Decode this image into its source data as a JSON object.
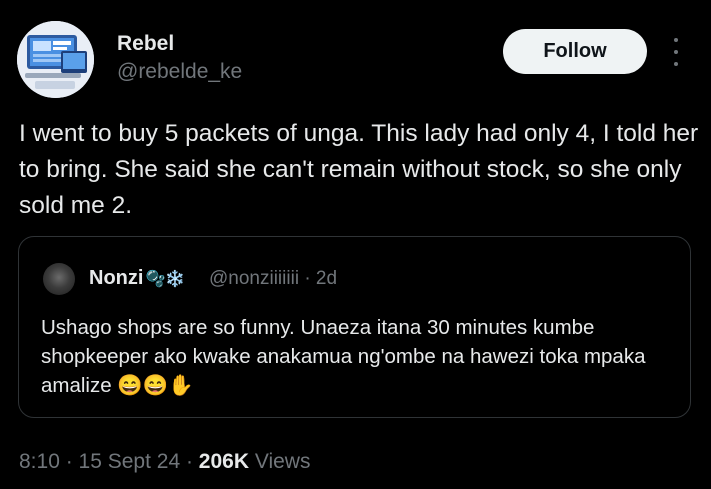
{
  "author": {
    "name": "Rebel",
    "handle": "@rebelde_ke"
  },
  "follow_label": "Follow",
  "more_icon": "more-vertical-icon",
  "tweet_text": "I went to buy 5 packets of unga. This lady had only 4, I told her to bring. She said she can't remain without stock, so she only sold me 2.",
  "quote": {
    "name": "Nonzi",
    "name_emoji": "🫧❄️",
    "handle": "@nonziiiiiii",
    "age": "· 2d",
    "text": "Ushago shops are so funny. Unaeza itana 30 minutes kumbe shopkeeper ako kwake anakamua ng'ombe na hawezi toka mpaka amalize 😄😄✋"
  },
  "meta": {
    "time_date": "8:10 · 15 Sept 24 · ",
    "views_count": "206K",
    "views_label": " Views"
  }
}
